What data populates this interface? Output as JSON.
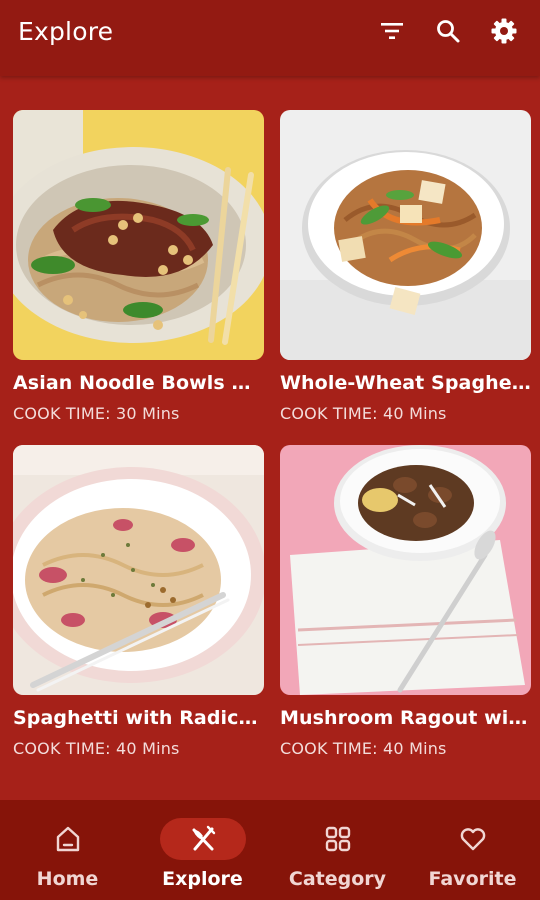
{
  "appbar": {
    "title": "Explore",
    "actions": [
      {
        "icon": "filter-icon"
      },
      {
        "icon": "search-icon"
      },
      {
        "icon": "gear-icon"
      }
    ]
  },
  "recipes": [
    {
      "title": "Asian Noodle Bowls wi...",
      "cook_time": "COOK TIME: 30 Mins",
      "image": "noodle-bowl-beef-photo"
    },
    {
      "title": "Whole-Wheat Spaghe...",
      "cook_time": "COOK TIME: 40 Mins",
      "image": "wholewheat-spaghetti-tofu-photo"
    },
    {
      "title": "Spaghetti with Radicc...",
      "cook_time": "COOK TIME: 40 Mins",
      "image": "spaghetti-radicchio-photo"
    },
    {
      "title": "Mushroom Ragout wit...",
      "cook_time": "COOK TIME: 40 Mins",
      "image": "mushroom-ragout-photo"
    }
  ],
  "bottom_nav": {
    "items": [
      {
        "label": "Home",
        "icon": "home-icon",
        "active": false
      },
      {
        "label": "Explore",
        "icon": "utensils-icon",
        "active": true
      },
      {
        "label": "Category",
        "icon": "grid-icon",
        "active": false
      },
      {
        "label": "Favorite",
        "icon": "heart-icon",
        "active": false
      }
    ]
  },
  "colors": {
    "background": "#a62119",
    "appbar": "#931a12",
    "bottom_nav": "#861409",
    "active_pill": "#b5281b"
  }
}
